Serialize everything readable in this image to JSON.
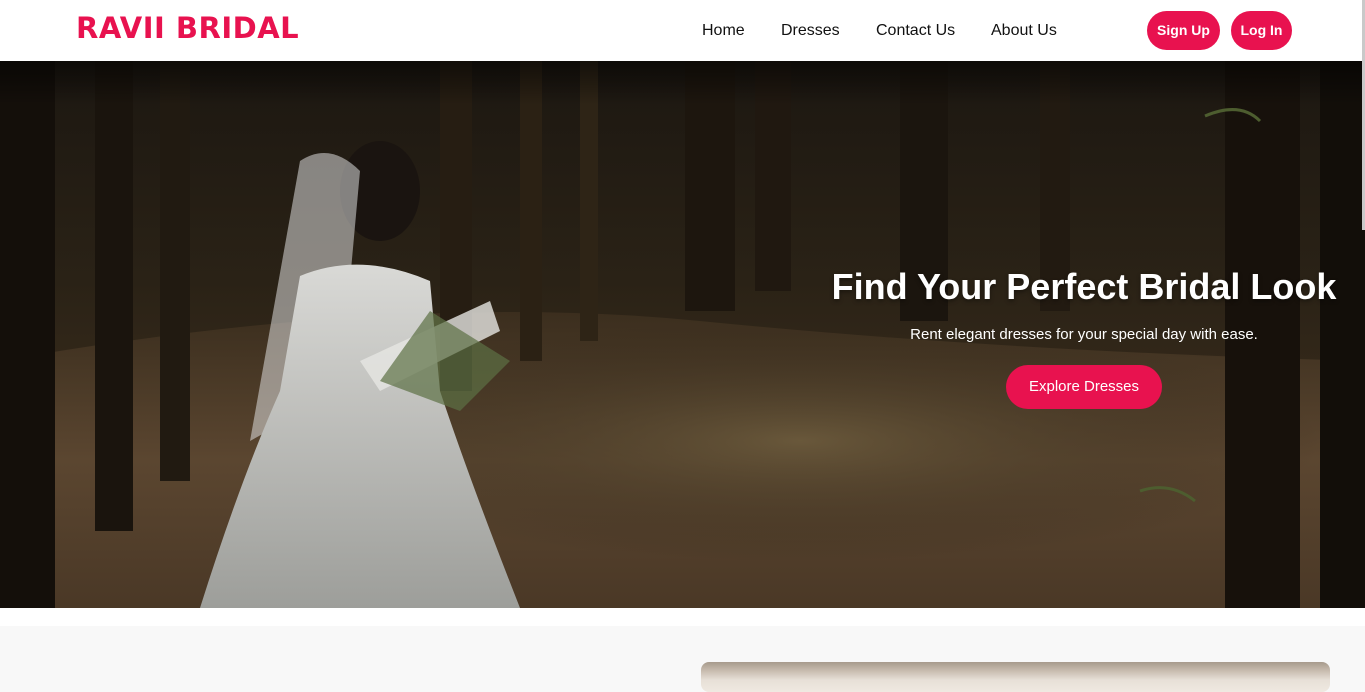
{
  "brand": {
    "name": "RAVII BRIDAL",
    "color": "#e8124f"
  },
  "nav": {
    "links": [
      "Home",
      "Dresses",
      "Contact Us",
      "About Us"
    ],
    "signup_label": "Sign Up",
    "login_label": "Log In"
  },
  "hero": {
    "title": "Find Your Perfect Bridal Look",
    "subtitle": "Rent elegant dresses for your special day with ease.",
    "cta_label": "Explore Dresses"
  },
  "colors": {
    "accent": "#e8124f",
    "nav_text": "#111111",
    "section_bg": "#f8f8f8"
  }
}
